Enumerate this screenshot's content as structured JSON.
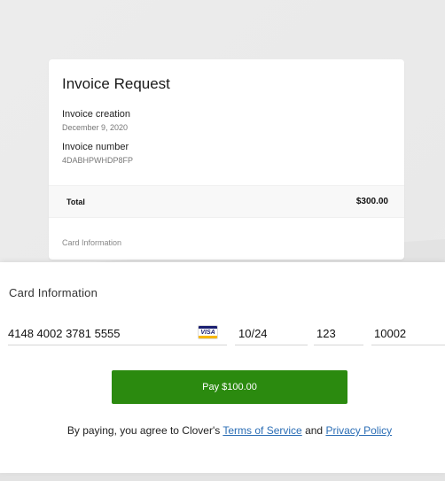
{
  "invoice": {
    "title": "Invoice Request",
    "creation_label": "Invoice creation",
    "creation_date": "December 9, 2020",
    "number_label": "Invoice number",
    "number_value": "4DABHPWHDP8FP",
    "total_label": "Total",
    "total_value": "$300.00",
    "card_info_label": "Card Information"
  },
  "payment": {
    "heading": "Card Information",
    "card_number": "4148 4002 3781 5555",
    "card_brand": "VISA",
    "expiry": "10/24",
    "cvv": "123",
    "zip": "10002",
    "pay_button_label": "Pay $100.00",
    "legal_prefix": "By paying, you agree to Clover's ",
    "terms_link": "Terms of Service",
    "legal_and": " and ",
    "privacy_link": "Privacy Policy"
  },
  "colors": {
    "pay_button": "#2b8a0f",
    "link": "#2a6db5",
    "visa_blue": "#1a1f71",
    "visa_gold": "#f7b600"
  }
}
